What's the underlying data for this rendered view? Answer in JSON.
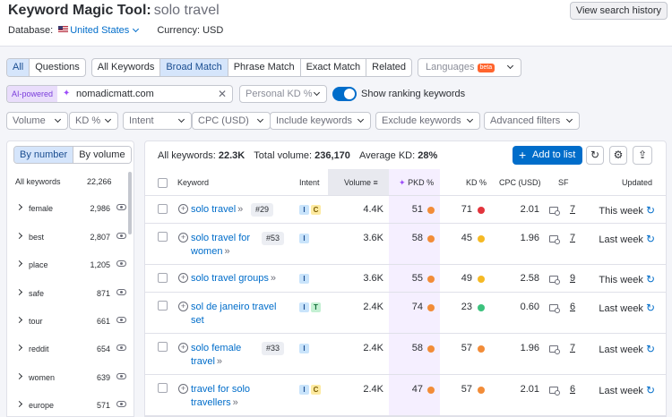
{
  "header": {
    "title": "Keyword Magic Tool:",
    "query": "solo travel",
    "view_history": "View search history",
    "database_label": "Database:",
    "database_value": "United States",
    "currency": "Currency: USD"
  },
  "match_tabs": {
    "all": "All",
    "questions": "Questions",
    "all_keywords": "All Keywords",
    "broad": "Broad Match",
    "phrase": "Phrase Match",
    "exact": "Exact Match",
    "related": "Related",
    "languages": "Languages",
    "beta": "beta"
  },
  "ai": {
    "label": "AI-powered",
    "domain_value": "nomadicmatt.com",
    "personal_kd": "Personal KD %",
    "ranking_toggle": "Show ranking keywords"
  },
  "filters": [
    "Volume",
    "KD %",
    "Intent",
    "CPC (USD)",
    "Include keywords",
    "Exclude keywords",
    "Advanced filters"
  ],
  "left_panel": {
    "by_number": "By number",
    "by_volume": "By volume",
    "all_label": "All keywords",
    "all_count": "22,266",
    "groups": [
      {
        "name": "female",
        "count": "2,986"
      },
      {
        "name": "best",
        "count": "2,807"
      },
      {
        "name": "place",
        "count": "1,205"
      },
      {
        "name": "safe",
        "count": "871"
      },
      {
        "name": "tour",
        "count": "661"
      },
      {
        "name": "reddit",
        "count": "654"
      },
      {
        "name": "women",
        "count": "639"
      },
      {
        "name": "europe",
        "count": "571"
      }
    ]
  },
  "summary": {
    "kw_label": "All keywords:",
    "kw_value": "22.3K",
    "vol_label": "Total volume:",
    "vol_value": "236,170",
    "kd_label": "Average KD:",
    "kd_value": "28%",
    "add_to_list": "Add to list"
  },
  "columns": {
    "keyword": "Keyword",
    "intent": "Intent",
    "volume": "Volume",
    "pkd": "PKD %",
    "kd": "KD %",
    "cpc": "CPC (USD)",
    "sf": "SF",
    "updated": "Updated"
  },
  "colors": {
    "accent": "#006dca",
    "orange": "#f28c38",
    "red": "#e2343c",
    "yellow": "#f5b924",
    "green": "#3cc27d"
  },
  "rows": [
    {
      "kw1": "solo travel",
      "kw2": "",
      "rank": "#29",
      "intents": [
        "I",
        "C"
      ],
      "volume": "4.4K",
      "pkd": "51",
      "pkd_color": "#f28c38",
      "kd": "71",
      "kd_color": "#e2343c",
      "cpc": "2.01",
      "sf": "7",
      "updated": "This week"
    },
    {
      "kw1": "solo travel for",
      "kw2": "women",
      "rank": "#53",
      "intents": [
        "I"
      ],
      "volume": "3.6K",
      "pkd": "58",
      "pkd_color": "#f28c38",
      "kd": "45",
      "kd_color": "#f5b924",
      "cpc": "1.96",
      "sf": "7",
      "updated": "Last week"
    },
    {
      "kw1": "solo travel groups",
      "kw2": "",
      "rank": "",
      "intents": [
        "I"
      ],
      "volume": "3.6K",
      "pkd": "55",
      "pkd_color": "#f28c38",
      "kd": "49",
      "kd_color": "#f5b924",
      "cpc": "2.58",
      "sf": "9",
      "updated": "This week"
    },
    {
      "kw1": "sol de janeiro travel",
      "kw2": "set",
      "rank": "",
      "intents": [
        "I",
        "T"
      ],
      "volume": "2.4K",
      "pkd": "74",
      "pkd_color": "#f28c38",
      "kd": "23",
      "kd_color": "#3cc27d",
      "cpc": "0.60",
      "sf": "6",
      "updated": "Last week"
    },
    {
      "kw1": "solo female",
      "kw2": "travel",
      "rank": "#33",
      "intents": [
        "I"
      ],
      "volume": "2.4K",
      "pkd": "58",
      "pkd_color": "#f28c38",
      "kd": "57",
      "kd_color": "#f28c38",
      "cpc": "1.96",
      "sf": "7",
      "updated": "Last week"
    },
    {
      "kw1": "travel for solo",
      "kw2": "travellers",
      "rank": "",
      "intents": [
        "I",
        "C"
      ],
      "volume": "2.4K",
      "pkd": "47",
      "pkd_color": "#f28c38",
      "kd": "57",
      "kd_color": "#f28c38",
      "cpc": "2.01",
      "sf": "6",
      "updated": "Last week"
    }
  ]
}
